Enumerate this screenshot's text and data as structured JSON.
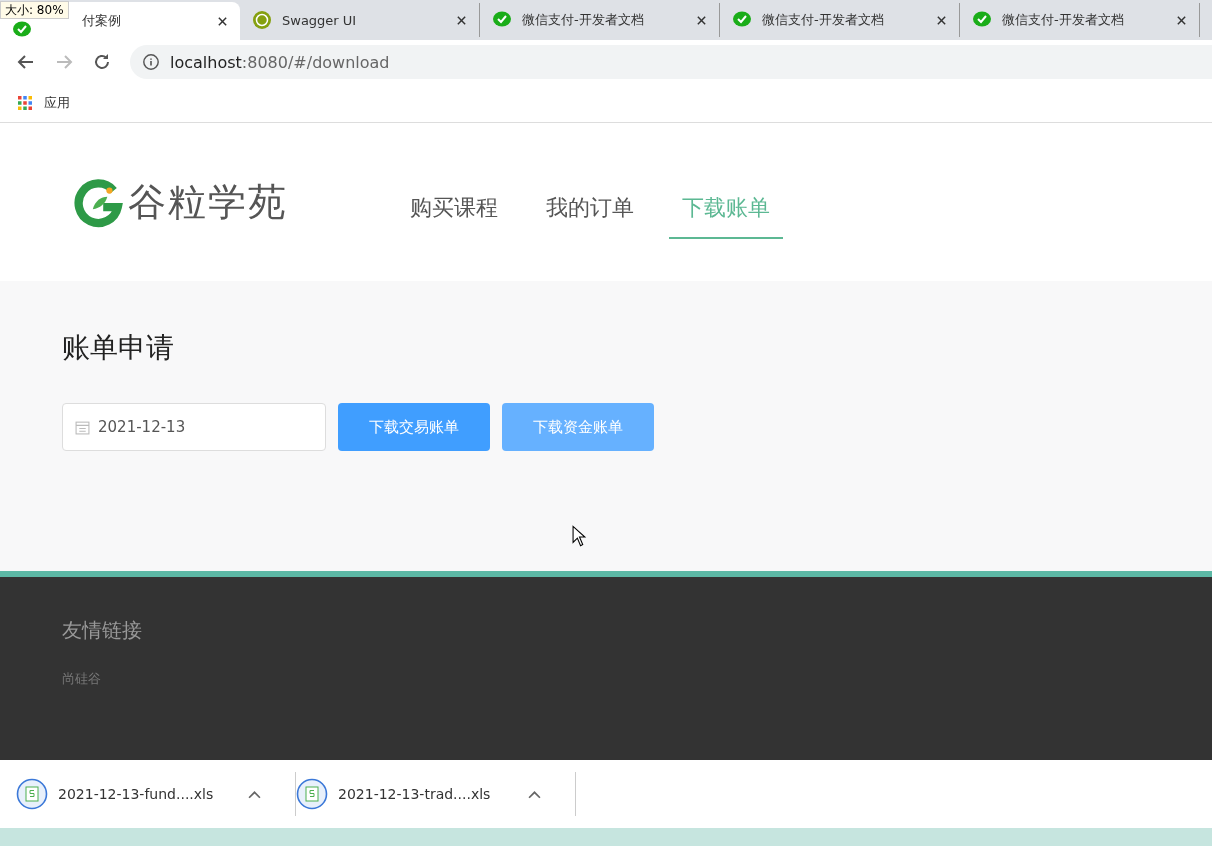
{
  "overlay_label": "大小: 80%",
  "tabs": [
    {
      "title": "付案例",
      "kind": "chat",
      "selected": true
    },
    {
      "title": "Swagger UI",
      "kind": "api",
      "selected": false
    },
    {
      "title": "微信支付-开发者文档",
      "kind": "chat",
      "selected": false
    },
    {
      "title": "微信支付-开发者文档",
      "kind": "chat",
      "selected": false
    },
    {
      "title": "微信支付-开发者文档",
      "kind": "chat",
      "selected": false
    }
  ],
  "address_bar": {
    "host": "localhost",
    "rest": ":8080/#/download"
  },
  "bookmarks": [
    "应用"
  ],
  "site": {
    "logo": "谷粒学苑",
    "nav": [
      {
        "label": "购买课程",
        "selected": false
      },
      {
        "label": "我的订单",
        "selected": false
      },
      {
        "label": "下载账单",
        "selected": true
      }
    ]
  },
  "bill_request": {
    "title": "账单申请",
    "date": "2021-12-13",
    "buttons": [
      {
        "label": "下载交易账单",
        "disabled": false
      },
      {
        "label": "下载资金账单",
        "disabled": true
      }
    ]
  },
  "footer": {
    "title": "友情链接",
    "links": [
      "尚硅谷"
    ]
  },
  "downloads": [
    {
      "file": "2021-12-13-fund....xls"
    },
    {
      "file": "2021-12-13-trad....xls"
    }
  ]
}
